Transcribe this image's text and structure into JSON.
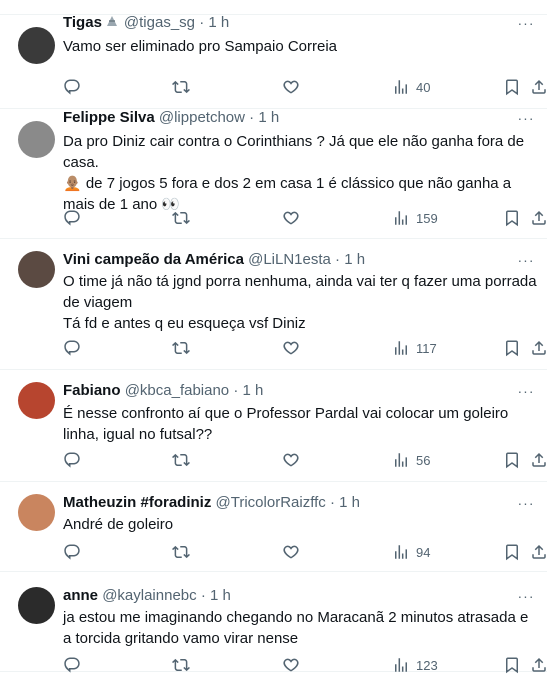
{
  "tweets": [
    {
      "name": "Tigas",
      "handle": "@tigas_sg",
      "dot": "·",
      "time": "1 h",
      "has_badge": true,
      "text": "Vamo ser eliminado pro Sampaio Correia",
      "views": "40",
      "avatar_color": "#3a3a3a"
    },
    {
      "name": "Felippe Silva",
      "handle": "@lippetchow",
      "dot": "·",
      "time": "1 h",
      "has_badge": false,
      "text": "Da pro Diniz cair contra o Corinthians ? Já que ele não ganha fora de casa.\n🧑🏽‍🦲 de 7 jogos 5 fora e dos 2 em casa 1 é clássico que não ganha a mais de 1 ano 👀",
      "views": "159",
      "avatar_color": "#8a8a8a"
    },
    {
      "name": "Vini campeão da América",
      "handle": "@LiLN1esta",
      "dot": "·",
      "time": "1 h",
      "has_badge": false,
      "text": "O time já não tá jgnd porra nenhuma, ainda vai ter q fazer uma porrada de viagem\nTá fd e antes q eu esqueça vsf Diniz",
      "views": "117",
      "avatar_color": "#5b4a42"
    },
    {
      "name": "Fabiano",
      "handle": "@kbca_fabiano",
      "dot": "·",
      "time": "1 h",
      "has_badge": false,
      "text": "É nesse confronto aí que o Professor Pardal vai colocar um goleiro linha, igual no futsal??",
      "views": "56",
      "avatar_color": "#b7452f"
    },
    {
      "name": "Matheuzin #foradiniz",
      "handle": "@TricolorRaizffc",
      "dot": "·",
      "time": "1 h",
      "has_badge": false,
      "text": "André de goleiro",
      "views": "94",
      "avatar_color": "#c9855f"
    },
    {
      "name": "anne",
      "handle": "@kaylainnebc",
      "dot": "·",
      "time": "1 h",
      "has_badge": false,
      "text": "ja estou me imaginando chegando no Maracanã 2 minutos atrasada e a torcida gritando vamo virar nense",
      "views": "123",
      "avatar_color": "#2b2b2b"
    }
  ],
  "more_glyph": "···",
  "colors": {
    "secondary": "#536471",
    "border": "#eff3f4",
    "text": "#0f1419"
  }
}
